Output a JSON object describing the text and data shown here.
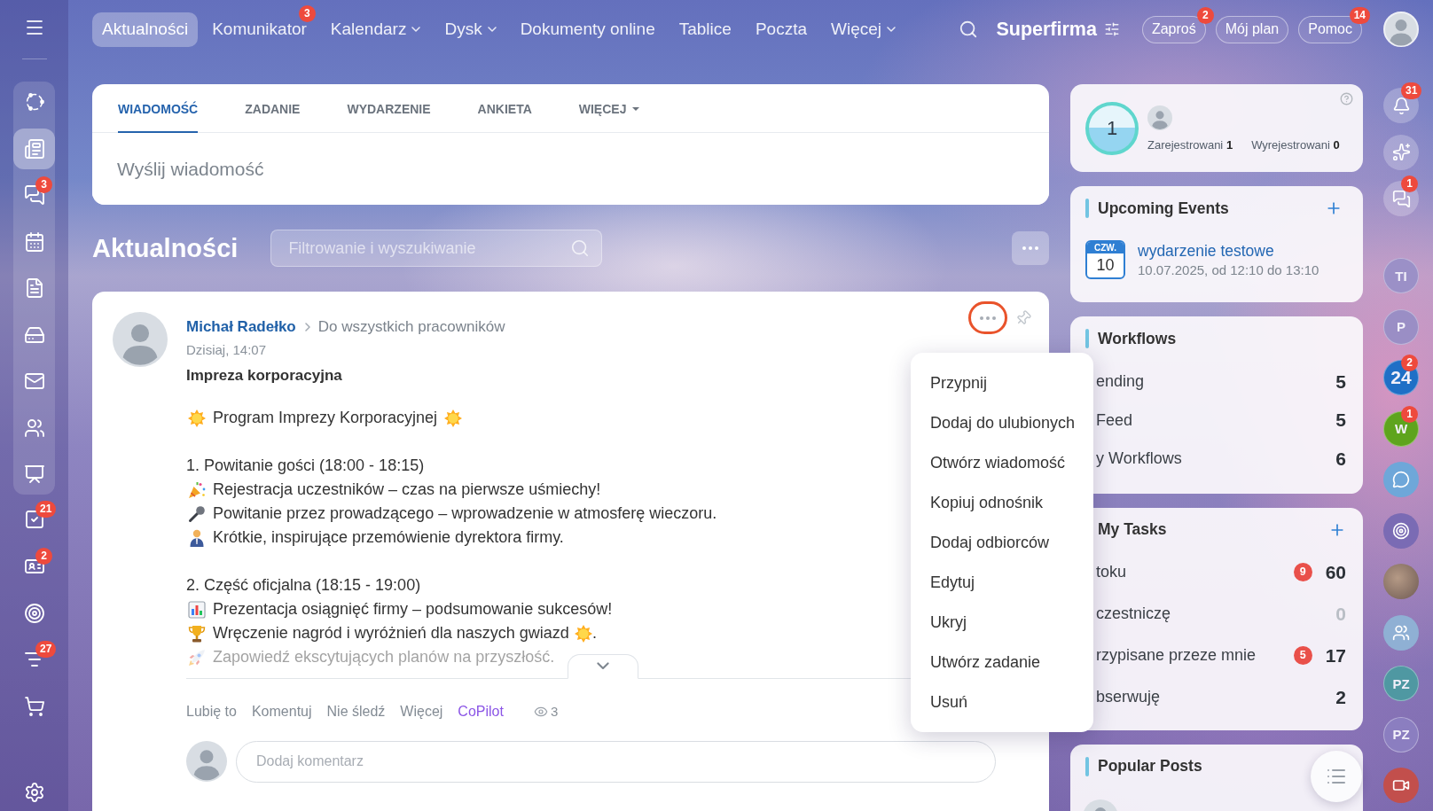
{
  "top_bar": {
    "nav": [
      {
        "label": "Aktualności",
        "selected": true,
        "dropdown": false
      },
      {
        "label": "Komunikator",
        "selected": false,
        "dropdown": false,
        "badge": "3"
      },
      {
        "label": "Kalendarz",
        "selected": false,
        "dropdown": true
      },
      {
        "label": "Dysk",
        "selected": false,
        "dropdown": true
      },
      {
        "label": "Dokumenty online",
        "selected": false,
        "dropdown": false
      },
      {
        "label": "Tablice",
        "selected": false,
        "dropdown": false
      },
      {
        "label": "Poczta",
        "selected": false,
        "dropdown": false
      },
      {
        "label": "Więcej",
        "selected": false,
        "dropdown": true
      }
    ],
    "company": "Superfirma",
    "buttons": [
      {
        "label": "Zaproś",
        "badge": "2"
      },
      {
        "label": "Mój plan"
      },
      {
        "label": "Pomoc",
        "badge": "14"
      }
    ]
  },
  "sidebar": {
    "group_items": [
      {
        "selected": false
      },
      {
        "selected": true
      },
      {
        "selected": false,
        "badge": "3"
      },
      {
        "selected": false
      },
      {
        "selected": false
      },
      {
        "selected": false
      },
      {
        "selected": false
      },
      {
        "selected": false
      },
      {
        "selected": false
      }
    ],
    "items": [
      {
        "selected": false,
        "badge": "21"
      },
      {
        "selected": false,
        "badge": "2"
      },
      {
        "selected": false
      },
      {
        "selected": false,
        "badge": "27"
      },
      {
        "selected": false
      }
    ]
  },
  "composer": {
    "tabs": [
      {
        "label": "WIADOMOŚĆ",
        "selected": true,
        "dropdown": false
      },
      {
        "label": "ZADANIE",
        "selected": false,
        "dropdown": false
      },
      {
        "label": "WYDARZENIE",
        "selected": false,
        "dropdown": false
      },
      {
        "label": "ANKIETA",
        "selected": false,
        "dropdown": false
      },
      {
        "label": "WIĘCEJ",
        "selected": false,
        "dropdown": true
      }
    ],
    "placeholder": "Wyślij wiadomość"
  },
  "feed": {
    "title": "Aktualności",
    "search": {
      "placeholder": "Filtrowanie i wyszukiwanie"
    }
  },
  "post": {
    "author": "Michał Radełko",
    "audience": "Do wszystkich pracowników",
    "time": "Dzisiaj, 14:07",
    "title": "Impreza korporacyjna",
    "more_button": {
      "highlighted": true
    },
    "body": {
      "expanded": false,
      "intro": "Program Imprezy Korporacyjnej",
      "sections": [
        {
          "heading": "1. Powitanie gości (18:00 - 18:15)",
          "items": [
            {
              "text": "Rejestracja uczestników – czas na pierwsze uśmiechy!",
              "trailing_icon": false
            },
            {
              "text": "Powitanie przez prowadzącego – wprowadzenie w atmosferę wieczoru.",
              "trailing_icon": false
            },
            {
              "text": "Krótkie, inspirujące przemówienie dyrektora firmy.",
              "trailing_icon": false
            }
          ]
        },
        {
          "heading": "2. Część oficjalna (18:15 - 19:00)",
          "items": [
            {
              "text": "Prezentacja osiągnięć firmy – podsumowanie sukcesów!",
              "trailing_icon": false
            },
            {
              "text": "Wręczenie nagród i wyróżnień dla naszych gwiazd",
              "trailing_icon": true,
              "tail": "."
            },
            {
              "text": "Zapowiedź ekscytujących planów na przyszłość.",
              "trailing_icon": false
            }
          ]
        }
      ]
    },
    "actions": [
      {
        "label": "Lubię to",
        "kind": "link"
      },
      {
        "label": "Komentuj",
        "kind": "link"
      },
      {
        "label": "Nie śledź",
        "kind": "link"
      },
      {
        "label": "Więcej",
        "kind": "link"
      },
      {
        "label": "CoPilot",
        "kind": "ai"
      }
    ],
    "views": "3",
    "comment": {
      "placeholder": "Dodaj komentarz"
    },
    "menu": {
      "open": true,
      "items": [
        "Przypnij",
        "Dodaj do ulubionych",
        "Otwórz wiadomość",
        "Kopiuj odnośnik",
        "Dodaj odbiorców",
        "Edytuj",
        "Ukryj",
        "Utwórz zadanie",
        "Usuń"
      ]
    }
  },
  "right_panel": {
    "online": {
      "count": "1",
      "stats": [
        {
          "label": "Zarejestrowani",
          "value": "1"
        },
        {
          "label": "Wyrejestrowani",
          "value": "0"
        }
      ]
    },
    "events": {
      "title": "Upcoming Events",
      "items": [
        {
          "weekday": "CZW.",
          "day": "10",
          "name": "wydarzenie testowe",
          "when": "10.07.2025, od 12:10 do 13:10"
        }
      ]
    },
    "workflows": {
      "title": "Workflows",
      "rows": [
        {
          "label": "ending",
          "count": "5"
        },
        {
          "label": "Feed",
          "count": "5"
        },
        {
          "label": "y Workflows",
          "count": "6"
        }
      ]
    },
    "tasks": {
      "title": "My Tasks",
      "rows": [
        {
          "label": "toku",
          "badge": "9",
          "count": "60",
          "dimmed": false
        },
        {
          "label": "czestniczę",
          "count": "0",
          "dimmed": true
        },
        {
          "label": "rzypisane przeze mnie",
          "badge": "5",
          "count": "17",
          "dimmed": false
        },
        {
          "label": "bserwuję",
          "count": "2",
          "dimmed": false
        }
      ]
    },
    "popular": {
      "title": "Popular Posts"
    }
  },
  "right_rail": {
    "items": [
      {
        "kind": "tool",
        "badge": "31"
      },
      {
        "kind": "tool"
      },
      {
        "kind": "tool",
        "badge": "1"
      },
      {
        "kind": "initials",
        "text": "TI",
        "color": "#9b90c7"
      },
      {
        "kind": "initials",
        "text": "P",
        "color": "#9a8ec5"
      },
      {
        "kind": "initials",
        "text": "24",
        "color": "#1f6fc6",
        "badge": "2"
      },
      {
        "kind": "initials",
        "text": "W",
        "color": "#5ea41d",
        "badge": "1"
      },
      {
        "kind": "icon",
        "color": "#6ea7d9"
      },
      {
        "kind": "icon",
        "color": "#7a6bb4"
      },
      {
        "kind": "photo"
      },
      {
        "kind": "icon",
        "color": "#8fb0d4"
      },
      {
        "kind": "initials",
        "text": "PZ",
        "color": "#4f98a2"
      },
      {
        "kind": "initials",
        "text": "PZ",
        "color": "#8b7ec0"
      },
      {
        "kind": "icon",
        "color": "#c24f4c"
      }
    ]
  }
}
